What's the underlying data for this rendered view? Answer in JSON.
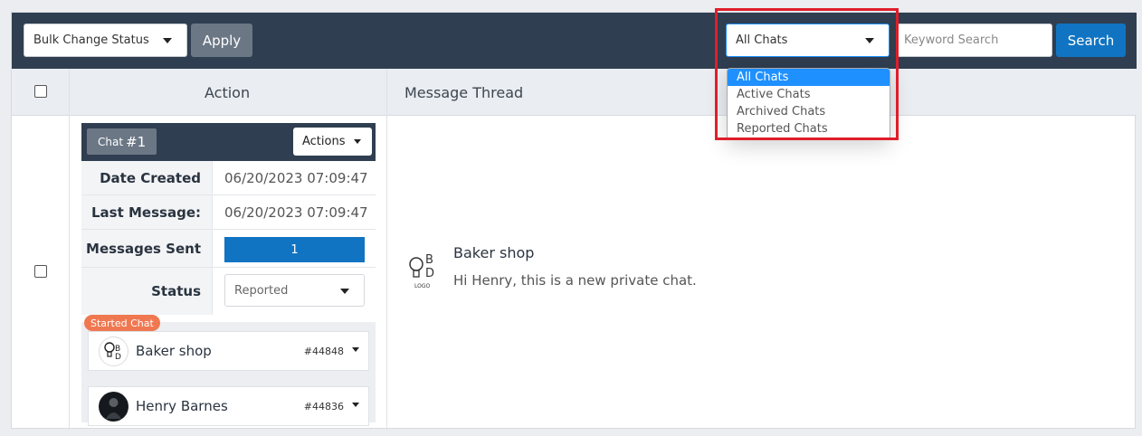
{
  "toolbar": {
    "bulk_label": "Bulk Change Status",
    "apply_label": "Apply",
    "chat_filter": "All Chats",
    "keyword_placeholder": "Keyword Search",
    "search_label": "Search"
  },
  "filter_dropdown": {
    "options": [
      "All Chats",
      "Active Chats",
      "Archived Chats",
      "Reported Chats"
    ],
    "selected": "All Chats"
  },
  "table": {
    "col_action": "Action",
    "col_thread": "Message Thread"
  },
  "chat": {
    "label": "Chat",
    "number": "#1",
    "actions_label": "Actions",
    "rows": [
      {
        "label": "Date Created",
        "value": "06/20/2023 07:09:47"
      },
      {
        "label": "Last Message:",
        "value": "06/20/2023 07:09:47"
      },
      {
        "label": "Messages Sent",
        "value": "1"
      },
      {
        "label": "Status",
        "value": "Reported"
      }
    ],
    "started_badge": "Started Chat",
    "participants": [
      {
        "name": "Baker shop",
        "id": "#44848",
        "avatar": "bd-logo-icon"
      },
      {
        "name": "Henry Barnes",
        "id": "#44836",
        "avatar": "person-photo"
      }
    ]
  },
  "thread": {
    "sender": "Baker shop",
    "message": "Hi Henry, this is a new private chat.",
    "logo_text": "LOGO"
  },
  "colors": {
    "toolbar_bg": "#2f3e50",
    "primary_blue": "#1074c2",
    "badge_orange": "#f07850",
    "highlight_red": "#e01e2a"
  }
}
